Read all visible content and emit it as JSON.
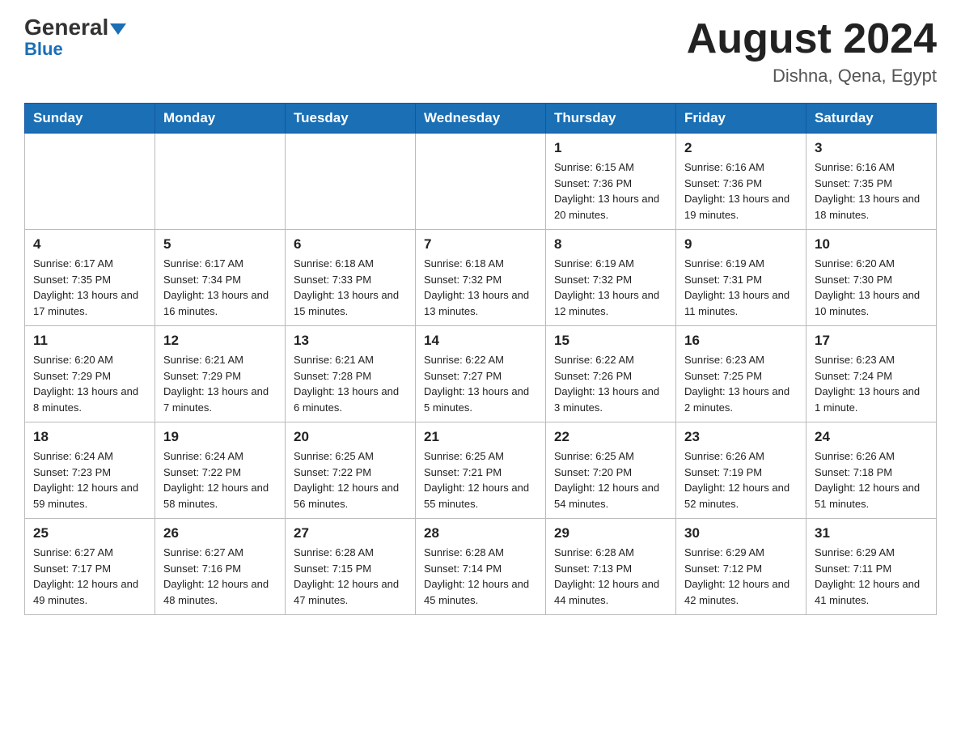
{
  "header": {
    "logo_general": "General",
    "logo_blue": "Blue",
    "main_title": "August 2024",
    "subtitle": "Dishna, Qena, Egypt"
  },
  "weekdays": [
    "Sunday",
    "Monday",
    "Tuesday",
    "Wednesday",
    "Thursday",
    "Friday",
    "Saturday"
  ],
  "weeks": [
    [
      {
        "day": "",
        "info": ""
      },
      {
        "day": "",
        "info": ""
      },
      {
        "day": "",
        "info": ""
      },
      {
        "day": "",
        "info": ""
      },
      {
        "day": "1",
        "info": "Sunrise: 6:15 AM\nSunset: 7:36 PM\nDaylight: 13 hours and 20 minutes."
      },
      {
        "day": "2",
        "info": "Sunrise: 6:16 AM\nSunset: 7:36 PM\nDaylight: 13 hours and 19 minutes."
      },
      {
        "day": "3",
        "info": "Sunrise: 6:16 AM\nSunset: 7:35 PM\nDaylight: 13 hours and 18 minutes."
      }
    ],
    [
      {
        "day": "4",
        "info": "Sunrise: 6:17 AM\nSunset: 7:35 PM\nDaylight: 13 hours and 17 minutes."
      },
      {
        "day": "5",
        "info": "Sunrise: 6:17 AM\nSunset: 7:34 PM\nDaylight: 13 hours and 16 minutes."
      },
      {
        "day": "6",
        "info": "Sunrise: 6:18 AM\nSunset: 7:33 PM\nDaylight: 13 hours and 15 minutes."
      },
      {
        "day": "7",
        "info": "Sunrise: 6:18 AM\nSunset: 7:32 PM\nDaylight: 13 hours and 13 minutes."
      },
      {
        "day": "8",
        "info": "Sunrise: 6:19 AM\nSunset: 7:32 PM\nDaylight: 13 hours and 12 minutes."
      },
      {
        "day": "9",
        "info": "Sunrise: 6:19 AM\nSunset: 7:31 PM\nDaylight: 13 hours and 11 minutes."
      },
      {
        "day": "10",
        "info": "Sunrise: 6:20 AM\nSunset: 7:30 PM\nDaylight: 13 hours and 10 minutes."
      }
    ],
    [
      {
        "day": "11",
        "info": "Sunrise: 6:20 AM\nSunset: 7:29 PM\nDaylight: 13 hours and 8 minutes."
      },
      {
        "day": "12",
        "info": "Sunrise: 6:21 AM\nSunset: 7:29 PM\nDaylight: 13 hours and 7 minutes."
      },
      {
        "day": "13",
        "info": "Sunrise: 6:21 AM\nSunset: 7:28 PM\nDaylight: 13 hours and 6 minutes."
      },
      {
        "day": "14",
        "info": "Sunrise: 6:22 AM\nSunset: 7:27 PM\nDaylight: 13 hours and 5 minutes."
      },
      {
        "day": "15",
        "info": "Sunrise: 6:22 AM\nSunset: 7:26 PM\nDaylight: 13 hours and 3 minutes."
      },
      {
        "day": "16",
        "info": "Sunrise: 6:23 AM\nSunset: 7:25 PM\nDaylight: 13 hours and 2 minutes."
      },
      {
        "day": "17",
        "info": "Sunrise: 6:23 AM\nSunset: 7:24 PM\nDaylight: 13 hours and 1 minute."
      }
    ],
    [
      {
        "day": "18",
        "info": "Sunrise: 6:24 AM\nSunset: 7:23 PM\nDaylight: 12 hours and 59 minutes."
      },
      {
        "day": "19",
        "info": "Sunrise: 6:24 AM\nSunset: 7:22 PM\nDaylight: 12 hours and 58 minutes."
      },
      {
        "day": "20",
        "info": "Sunrise: 6:25 AM\nSunset: 7:22 PM\nDaylight: 12 hours and 56 minutes."
      },
      {
        "day": "21",
        "info": "Sunrise: 6:25 AM\nSunset: 7:21 PM\nDaylight: 12 hours and 55 minutes."
      },
      {
        "day": "22",
        "info": "Sunrise: 6:25 AM\nSunset: 7:20 PM\nDaylight: 12 hours and 54 minutes."
      },
      {
        "day": "23",
        "info": "Sunrise: 6:26 AM\nSunset: 7:19 PM\nDaylight: 12 hours and 52 minutes."
      },
      {
        "day": "24",
        "info": "Sunrise: 6:26 AM\nSunset: 7:18 PM\nDaylight: 12 hours and 51 minutes."
      }
    ],
    [
      {
        "day": "25",
        "info": "Sunrise: 6:27 AM\nSunset: 7:17 PM\nDaylight: 12 hours and 49 minutes."
      },
      {
        "day": "26",
        "info": "Sunrise: 6:27 AM\nSunset: 7:16 PM\nDaylight: 12 hours and 48 minutes."
      },
      {
        "day": "27",
        "info": "Sunrise: 6:28 AM\nSunset: 7:15 PM\nDaylight: 12 hours and 47 minutes."
      },
      {
        "day": "28",
        "info": "Sunrise: 6:28 AM\nSunset: 7:14 PM\nDaylight: 12 hours and 45 minutes."
      },
      {
        "day": "29",
        "info": "Sunrise: 6:28 AM\nSunset: 7:13 PM\nDaylight: 12 hours and 44 minutes."
      },
      {
        "day": "30",
        "info": "Sunrise: 6:29 AM\nSunset: 7:12 PM\nDaylight: 12 hours and 42 minutes."
      },
      {
        "day": "31",
        "info": "Sunrise: 6:29 AM\nSunset: 7:11 PM\nDaylight: 12 hours and 41 minutes."
      }
    ]
  ]
}
